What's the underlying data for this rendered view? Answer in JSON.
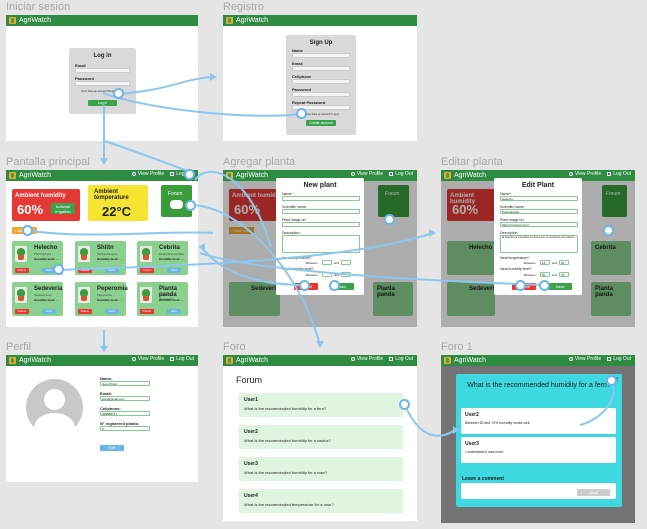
{
  "app_name": "AgriWatch",
  "frames": {
    "login": "Iniciar sesión",
    "register": "Registro",
    "main": "Pantalla principal",
    "add": "Agregar planta",
    "edit": "Editar planta",
    "profile": "Perfil",
    "forum": "Foro",
    "forum1": "Foro 1"
  },
  "nav": {
    "view_profile": "View Profile",
    "logout": "Log Out"
  },
  "login": {
    "title": "Log in",
    "email": "Email",
    "password": "Password",
    "register_prompt": "Don't have an account? Register here",
    "button": "Log in"
  },
  "register": {
    "title": "Sign Up",
    "name": "Name",
    "email": "Email",
    "cellphone": "Cellphone",
    "password": "Password",
    "repeat": "Repeat Password",
    "login_prompt": "Already have an account? Log In",
    "button": "Create account"
  },
  "dashboard": {
    "humidity_title": "Ambient humidity",
    "humidity_value": "60%",
    "irrigation": "Activate irrigation",
    "temp_title": "Ambient temperature",
    "temp_value": "22°C",
    "forum": "Forum",
    "add_plant": "+ Add plant"
  },
  "plants": [
    {
      "name": "Helecho",
      "sci": "Pteridophyta",
      "hum": "Humidity level: ..."
    },
    {
      "name": "Shlitn",
      "sci": "Schlumbergera",
      "hum": "Humidity level: ..."
    },
    {
      "name": "Cebrita",
      "sci": "Haworthia fasciata",
      "hum": "Humidity level: ..."
    },
    {
      "name": "Sedeveria",
      "sci": "Sedeveria sp.",
      "hum": "Humidity level: ..."
    },
    {
      "name": "Peperomia",
      "sci": "Peperomia",
      "hum": "Humidity level: ..."
    },
    {
      "name": "Planta panda",
      "sci": "Kalanchoe tomentosa",
      "hum": "Humidity level: ..."
    }
  ],
  "plant_buttons": {
    "delete": "Delete",
    "edit": "Edit"
  },
  "add_modal": {
    "title": "New plant",
    "name": "Name*:",
    "sci": "Scientific name:",
    "image": "Plant image url:",
    "desc": "Description:",
    "temp": "Ideal temperature*:",
    "hum": "Ideal humidity level*:",
    "between": "Between",
    "and": "and",
    "cancel": "Cancel",
    "add": "Add"
  },
  "edit_modal": {
    "title": "Edit Plant",
    "name": "Name*:",
    "name_val": "Helecho",
    "sci": "Scientific name:",
    "sci_val": "Pteridophyta",
    "image": "Plant image url:",
    "image_val": "https://i.pinimg.com/...",
    "desc": "Description:",
    "desc_val": "El helecho es una planta sin flores que se reproduce por esporas...",
    "temp": "Ideal temperature*:",
    "temp_min": "18",
    "temp_max": "25",
    "hum": "Ideal humidity level*:",
    "hum_min": "50",
    "hum_max": "70",
    "between": "Between",
    "and": "and",
    "cancel": "Cancel",
    "save": "Save"
  },
  "profile": {
    "name_label": "Name:",
    "name_val": "Juan Pérez",
    "email_label": "Email:",
    "email_val": "juan@gmail.com",
    "cell_label": "Cellphone:",
    "cell_val": "999888777",
    "plants_label": "N° registered plants:",
    "plants_val": "6",
    "edit": "Edit"
  },
  "forum": {
    "title": "Forum",
    "questions": [
      {
        "user": "User1",
        "text": "What is the recommended humidity for a fern?"
      },
      {
        "user": "User2",
        "text": "What is the recommended humidity for a cactus?"
      },
      {
        "user": "User3",
        "text": "What is the recommended humidity for a rose?"
      },
      {
        "user": "User4",
        "text": "What is the recommended temperature for a rose?"
      }
    ]
  },
  "forum1": {
    "question": "What is the recommended humidity for a fern?",
    "answers": [
      {
        "user": "User2",
        "text": "Between 50 and 70% humidity works well."
      },
      {
        "user": "User3",
        "text": "I understand it was more."
      }
    ],
    "comment_label": "Leave a comment",
    "send": "Send"
  },
  "colors": {
    "topbar": "#2e8b42",
    "humidity_card": "#e53935",
    "temp_card": "#f5e431",
    "forum_card": "#3a9d3a",
    "plant_card": "#8ad08e",
    "connector": "#6bb6e8"
  }
}
